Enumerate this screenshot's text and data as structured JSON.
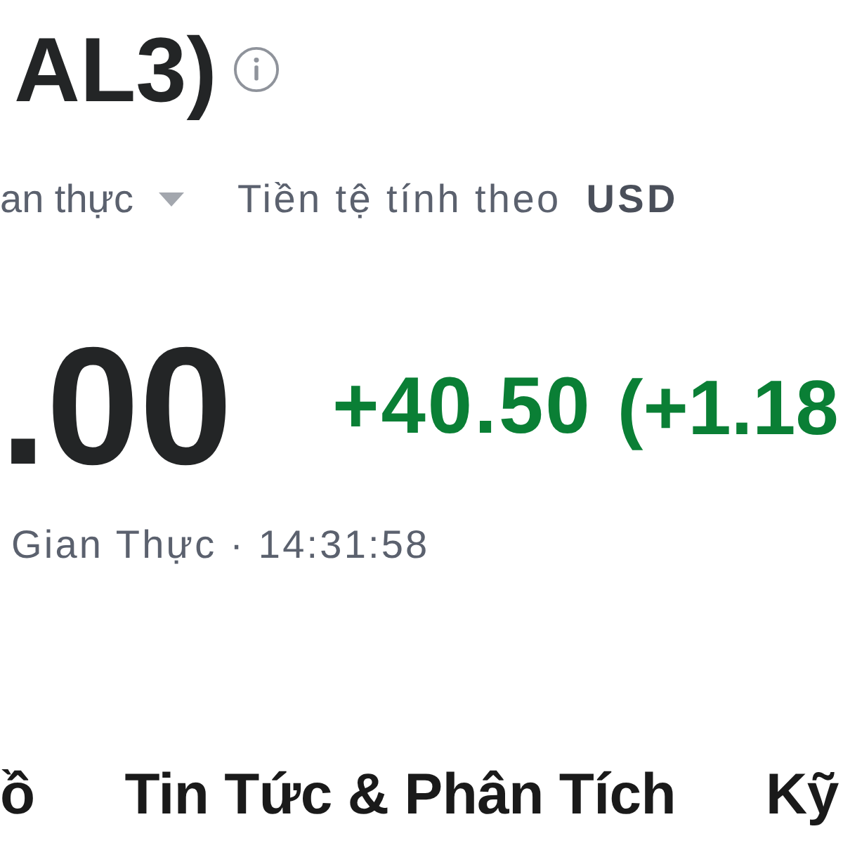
{
  "header": {
    "title": "AL3)"
  },
  "meta": {
    "price_type": "an thực",
    "currency_label": "Tiền tệ tính theo",
    "currency": "USD"
  },
  "quote": {
    "price": ".00",
    "positive": true,
    "change": "+40.50",
    "change_percent": "(+1.18",
    "status": "Gian Thực · 14:31:58"
  },
  "tabs": [
    {
      "label": "ồ"
    },
    {
      "label": "Tin Tức & Phân Tích"
    },
    {
      "label": "Kỹ"
    }
  ]
}
